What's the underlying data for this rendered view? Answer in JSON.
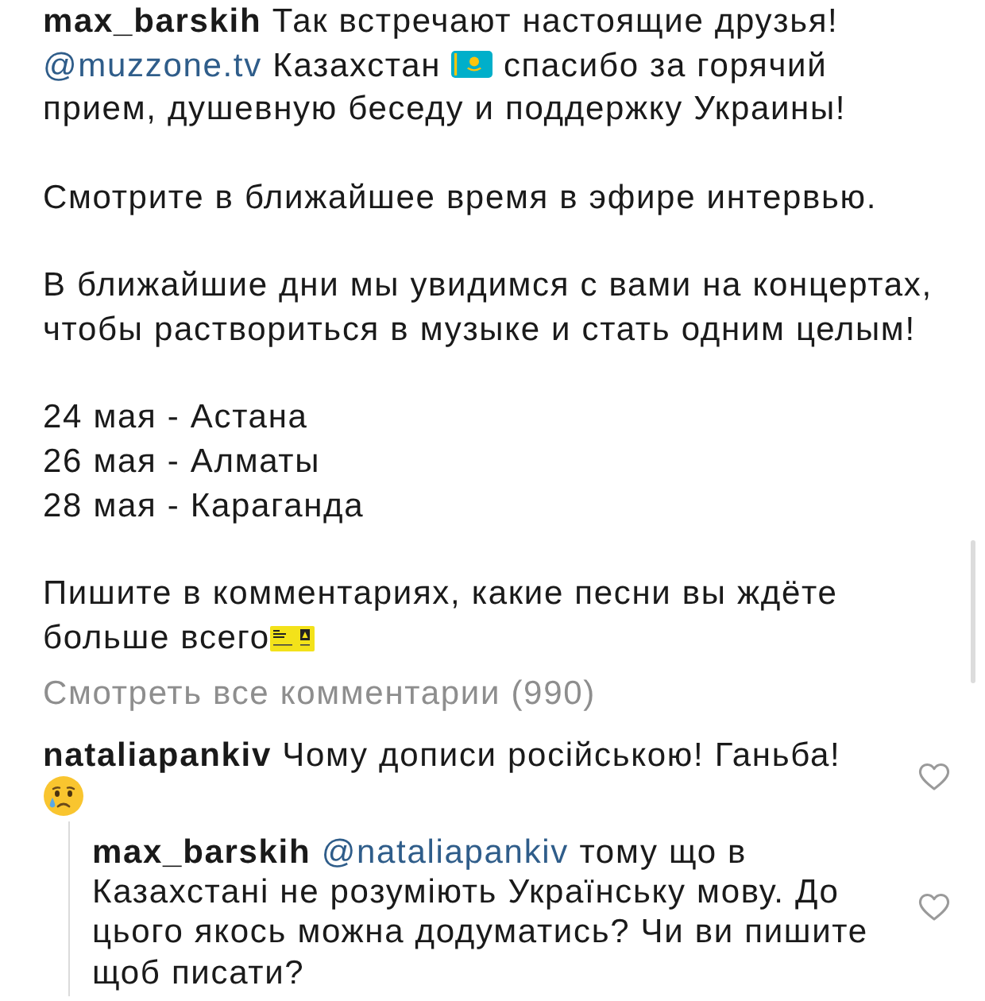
{
  "post": {
    "username": "max_barskih",
    "caption": [
      {
        "kind": "paragraph",
        "parts": [
          {
            "kind": "text",
            "text": "Так встречают настоящие друзья!"
          },
          {
            "kind": "mention",
            "text": "@muzzone.tv"
          },
          {
            "kind": "text",
            "text": "Казахстан"
          },
          {
            "kind": "flag_emoji"
          },
          {
            "kind": "text",
            "text": "спасибо за горячий прием, душевную беседу и поддержку Украины!"
          }
        ]
      },
      {
        "kind": "paragraph",
        "parts": [
          {
            "kind": "text",
            "text": "Смотрите в ближайшее время в эфире интервью."
          }
        ]
      },
      {
        "kind": "paragraph",
        "parts": [
          {
            "kind": "text",
            "text": "В ближайшие дни мы увидимся с вами на концертах, чтобы раствориться в музыке и стать одним целым!"
          }
        ]
      },
      {
        "kind": "lines",
        "lines": [
          "24 мая - Астана",
          "26 мая - Алматы",
          "28 мая - Караганда"
        ]
      },
      {
        "kind": "paragraph",
        "parts": [
          {
            "kind": "text",
            "text": "Пишите в комментариях, какие песни вы ждёте больше всего"
          },
          {
            "kind": "ticket_emoji",
            "glued": true
          }
        ]
      }
    ],
    "view_all_comments": "Смотреть все комментарии (990)"
  },
  "comments": [
    {
      "username": "nataliapankiv",
      "parts": [
        {
          "kind": "text",
          "text": "Чому дописи російською! Ганьба!"
        },
        {
          "kind": "crying_emoji"
        }
      ],
      "liked": false,
      "replies": [
        {
          "username": "max_barskih",
          "parts": [
            {
              "kind": "mention",
              "text": "@nataliapankiv"
            },
            {
              "kind": "text",
              "text": "тому що в Казахстані не розуміють Українську мову. До цього якось можна додуматись? Чи ви пишите щоб писати?"
            }
          ],
          "liked": false
        }
      ]
    }
  ]
}
